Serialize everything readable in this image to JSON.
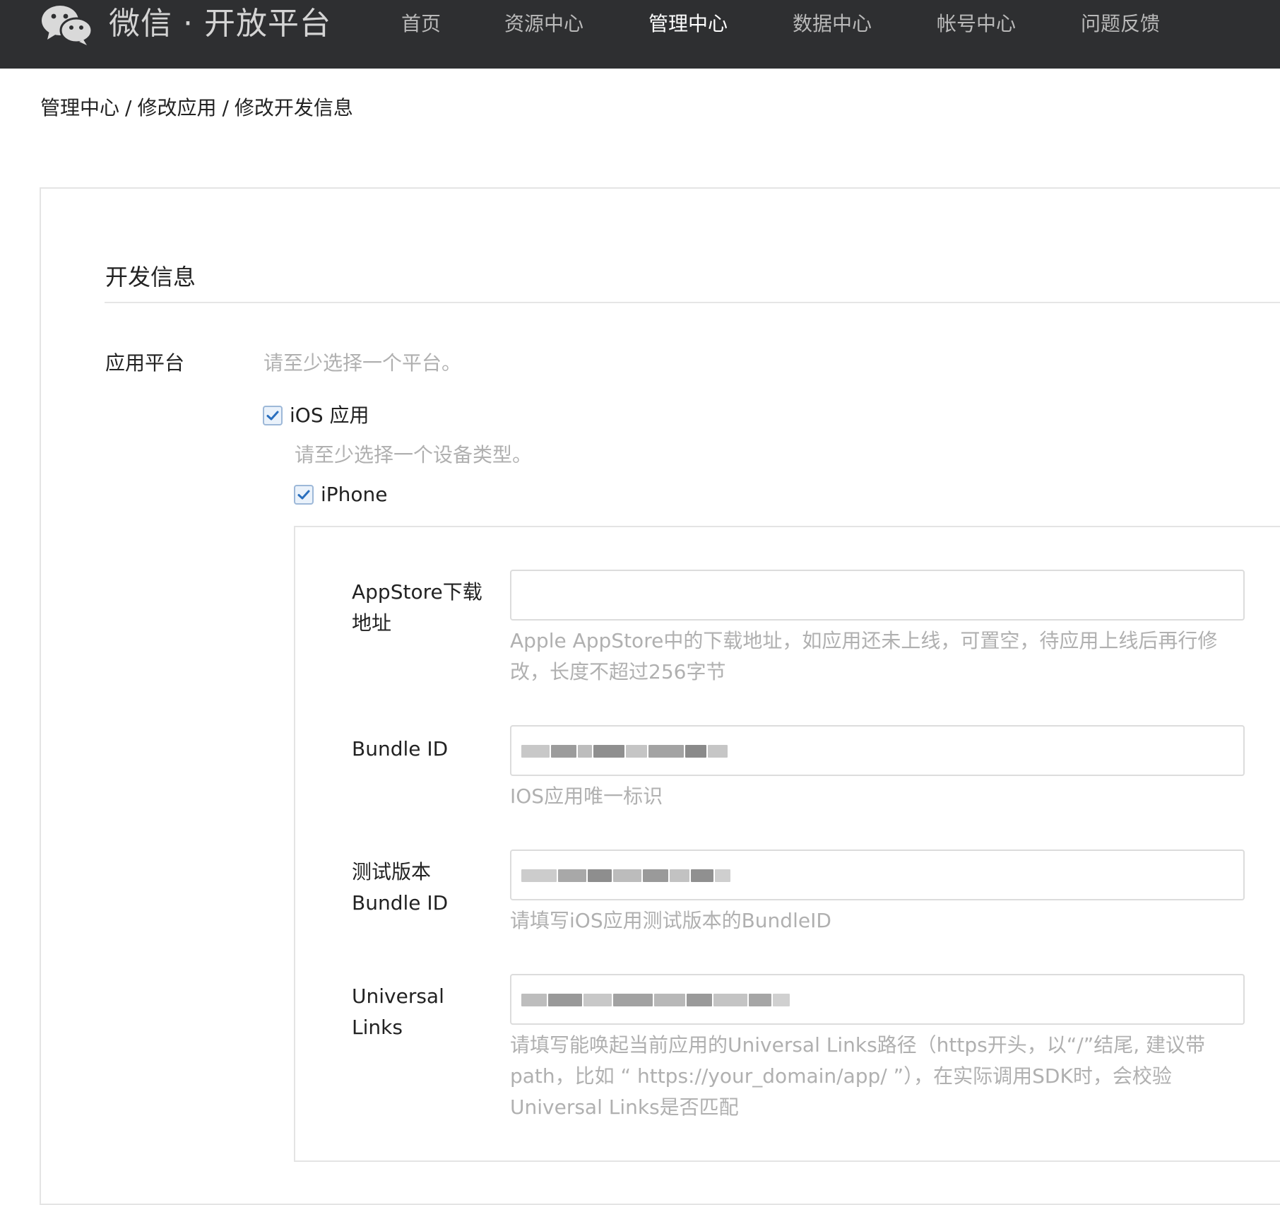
{
  "header": {
    "brand_name": "微信 · 开放平台",
    "nav": [
      {
        "label": "首页"
      },
      {
        "label": "资源中心"
      },
      {
        "label": "管理中心"
      },
      {
        "label": "数据中心"
      },
      {
        "label": "帐号中心"
      },
      {
        "label": "问题反馈"
      }
    ],
    "active_nav": "管理中心",
    "background_color": "#2e2f31"
  },
  "breadcrumb": {
    "items": [
      "管理中心",
      "修改应用",
      "修改开发信息"
    ],
    "separator": "/"
  },
  "section": {
    "title": "开发信息"
  },
  "platform": {
    "label": "应用平台",
    "hint": "请至少选择一个平台。",
    "ios_checkbox": {
      "label": "iOS 应用",
      "checked": true
    },
    "device_hint": "请至少选择一个设备类型。",
    "iphone_checkbox": {
      "label": "iPhone",
      "checked": true
    }
  },
  "form": {
    "appstore": {
      "label_line1": "AppStore下载",
      "label_line2": "地址",
      "value": "",
      "hint": "Apple AppStore中的下载地址，如应用还未上线，可置空，待应用上线后再行修改，长度不超过256字节"
    },
    "bundle_id": {
      "label": "Bundle ID",
      "hint": "IOS应用唯一标识"
    },
    "test_bundle_id": {
      "label_line1": "测试版本",
      "label_line2": "Bundle ID",
      "hint": "请填写iOS应用测试版本的BundleID"
    },
    "universal_links": {
      "label_line1": "Universal",
      "label_line2": "Links",
      "hint": "请填写能唤起当前应用的Universal Links路径（https开头，以“/”结尾, 建议带path，比如 “ https://your_domain/app/ ”），在实际调用SDK时，会校验Universal Links是否匹配"
    }
  },
  "colors": {
    "accent_check": "#2a6fbe",
    "hint_text": "#b0b0b0",
    "border": "#e4e4e4"
  }
}
